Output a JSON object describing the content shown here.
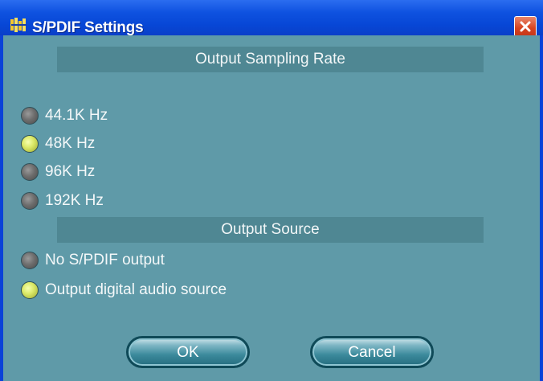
{
  "window": {
    "title": "S/PDIF Settings",
    "close_label": "Close"
  },
  "sampling": {
    "header": "Output Sampling Rate",
    "options": [
      {
        "label": "44.1K Hz",
        "selected": false
      },
      {
        "label": "48K Hz",
        "selected": true
      },
      {
        "label": "96K Hz",
        "selected": false
      },
      {
        "label": "192K Hz",
        "selected": false
      }
    ]
  },
  "source": {
    "header": "Output Source",
    "options": [
      {
        "label": "No S/PDIF output",
        "selected": false
      },
      {
        "label": "Output digital audio source",
        "selected": true
      }
    ]
  },
  "buttons": {
    "ok": "OK",
    "cancel": "Cancel"
  },
  "colors": {
    "titlebar": "#0a52e0",
    "client_bg": "#5f9aa8",
    "header_bg": "#4f8793",
    "radio_on": "#dcea6a",
    "radio_off": "#6e6e6e"
  }
}
